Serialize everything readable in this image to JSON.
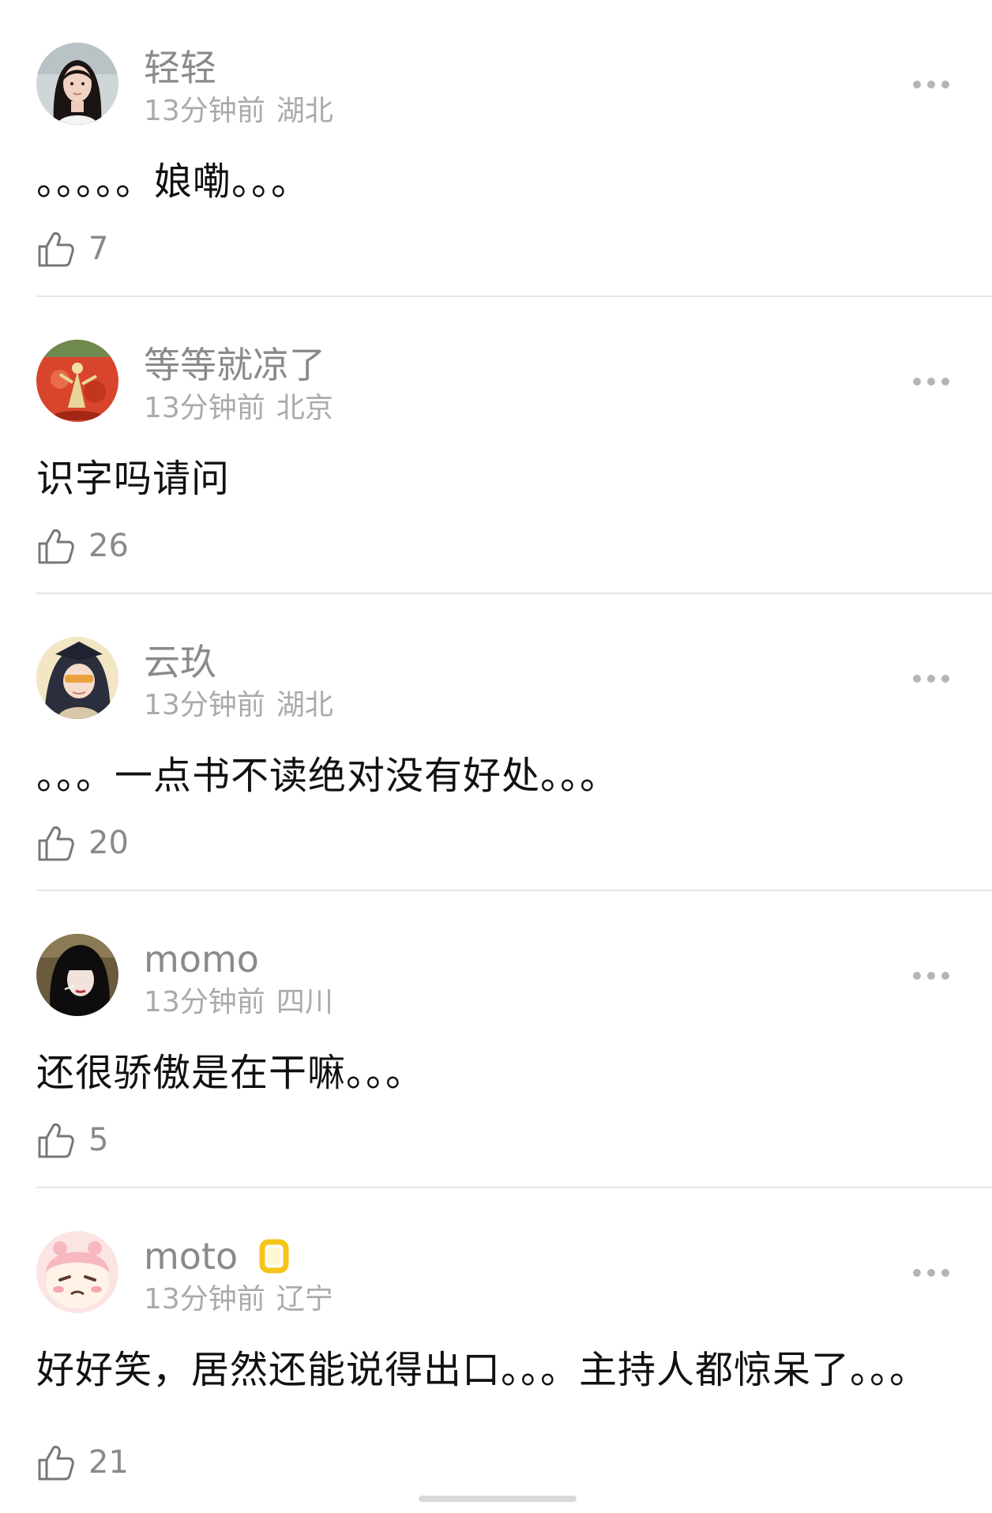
{
  "comments": [
    {
      "name": "轻轻",
      "time": "13分钟前",
      "location": "湖北",
      "text": "。。。。。娘嘞。。。",
      "likes": "7",
      "avatar_icon": "girl-portrait-avatar",
      "badge_icon": ""
    },
    {
      "name": "等等就凉了",
      "time": "13分钟前",
      "location": "北京",
      "text": "识字吗请问",
      "likes": "26",
      "avatar_icon": "red-painting-avatar",
      "badge_icon": ""
    },
    {
      "name": "云玖",
      "time": "13分钟前",
      "location": "湖北",
      "text": "。。。一点书不读绝对没有好处。。。",
      "likes": "20",
      "avatar_icon": "anime-girl-avatar",
      "badge_icon": ""
    },
    {
      "name": "momo",
      "time": "13分钟前",
      "location": "四川",
      "text": "还很骄傲是在干嘛。。。",
      "likes": "5",
      "avatar_icon": "dark-hair-girl-avatar",
      "badge_icon": ""
    },
    {
      "name": "moto",
      "time": "13分钟前",
      "location": "辽宁",
      "text": "好好笑，居然还能说得出口。。。主持人都惊呆了。。。",
      "likes": "21",
      "avatar_icon": "pink-cartoon-avatar",
      "badge_icon": "gold-frame-badge-icon"
    }
  ],
  "icons": {
    "more": "more-dots-icon",
    "like": "thumbs-up-icon"
  },
  "colors": {
    "name": "#8a8a8a",
    "meta": "#aaaaaa",
    "text": "#111111",
    "divider": "#e6e6e6",
    "badge": "#f5c518"
  }
}
